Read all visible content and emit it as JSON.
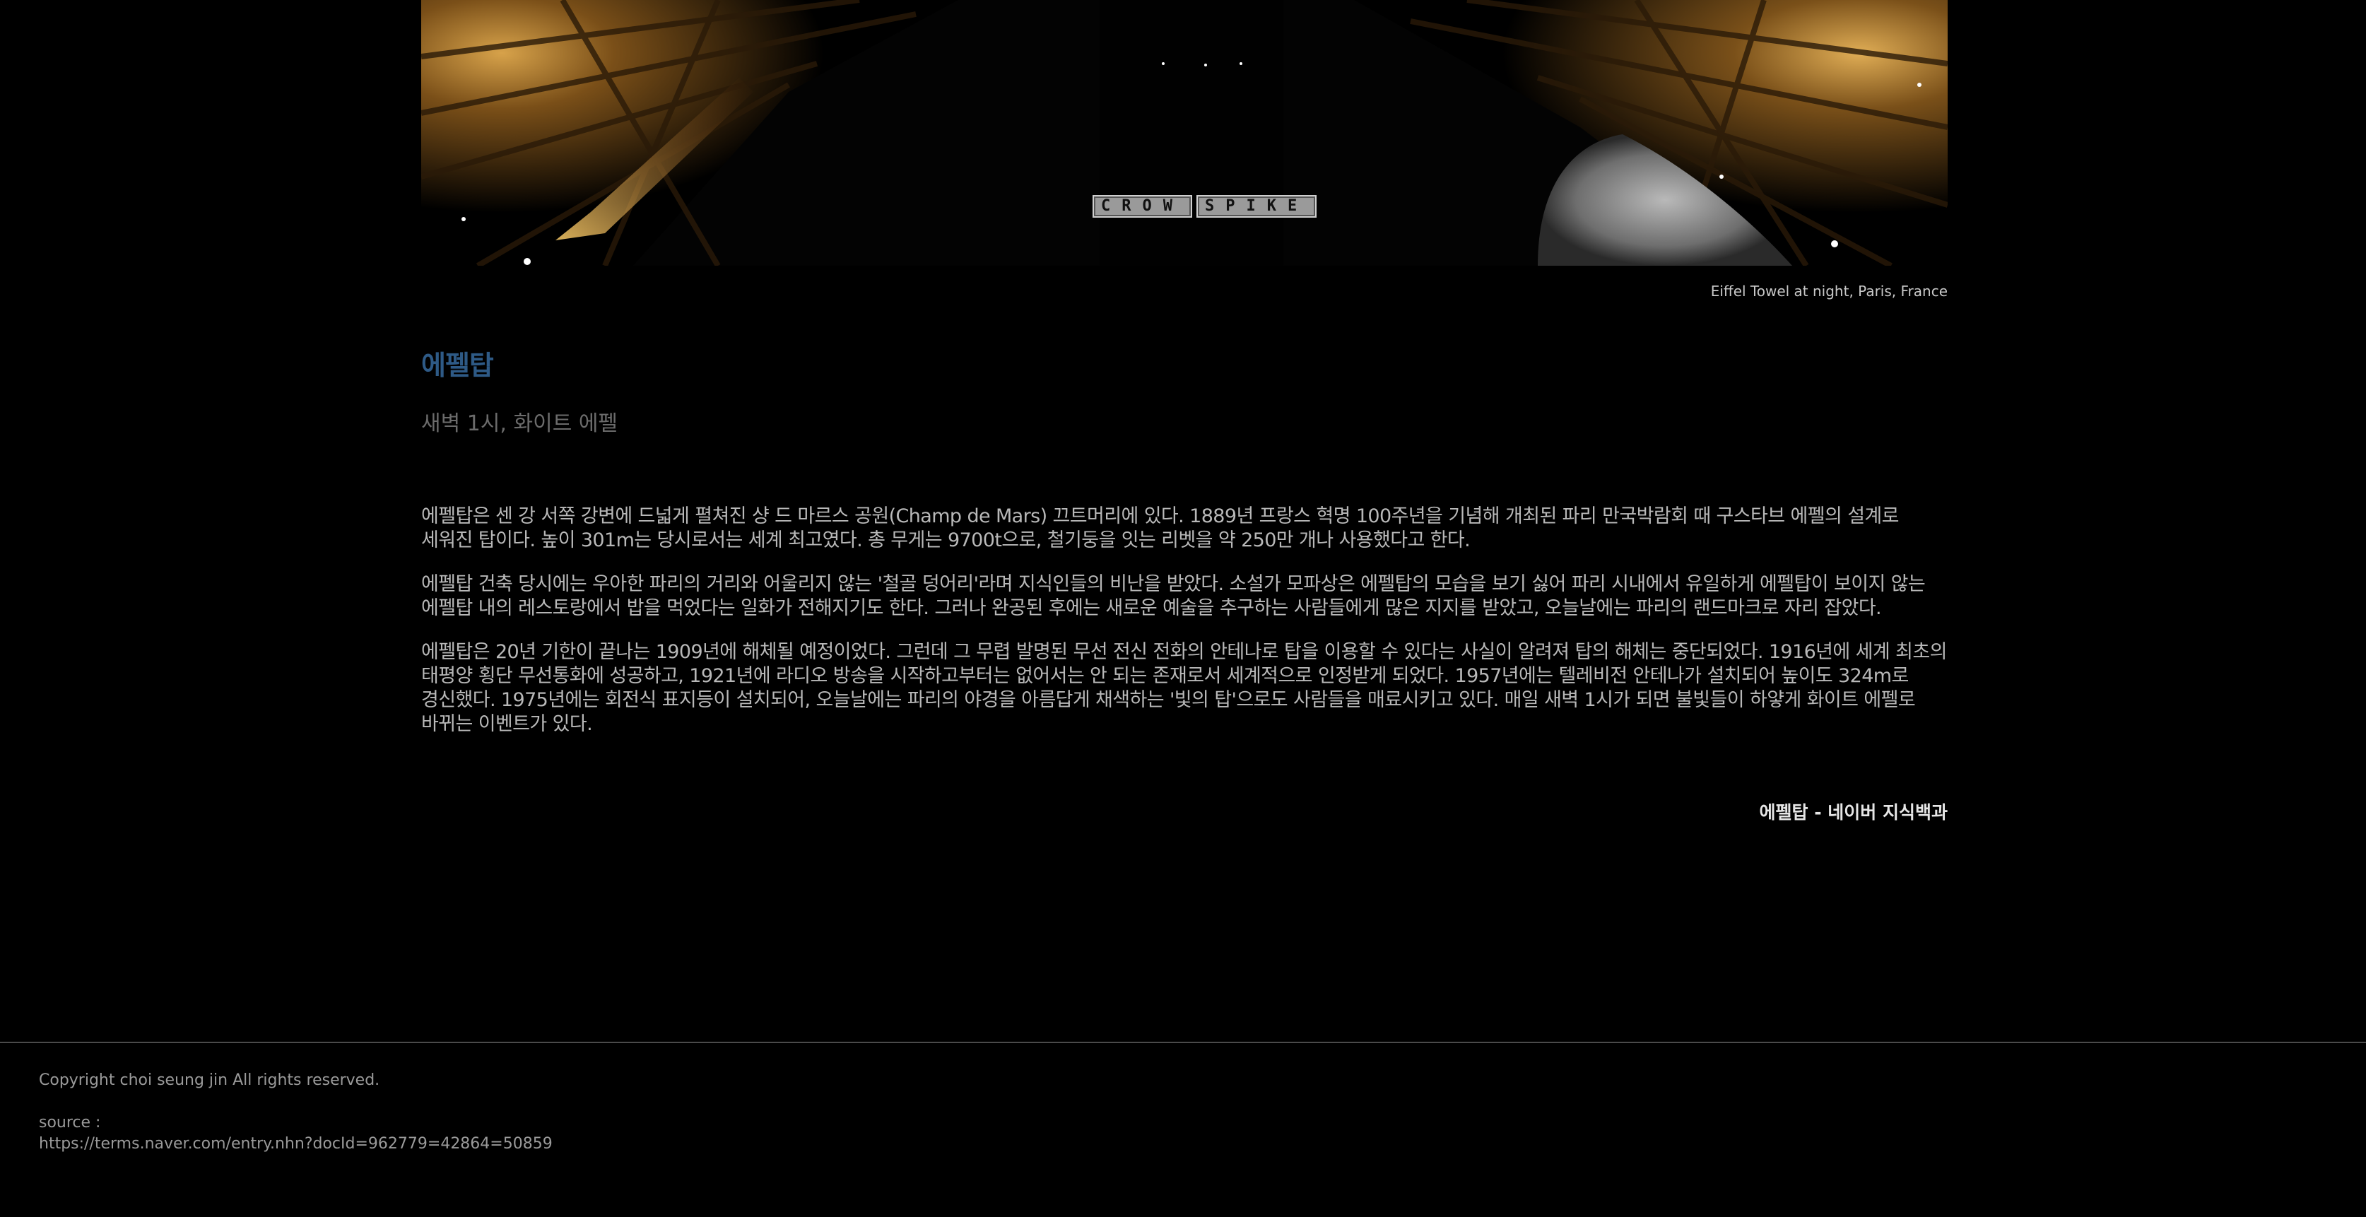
{
  "hero": {
    "watermark_left": "CROW",
    "watermark_right": "SPIKE",
    "caption": "Eiffel Towel at night, Paris, France"
  },
  "article": {
    "title": "에펠탑",
    "subtitle": "새벽 1시, 화이트 에펠",
    "paragraphs": [
      "에펠탑은 센 강 서쪽 강변에 드넓게 펼쳐진 샹 드 마르스 공원(Champ de Mars) 끄트머리에 있다. 1889년 프랑스 혁명 100주년을 기념해 개최된 파리 만국박람회 때 구스타브 에펠의 설계로 세워진 탑이다. 높이 301m는 당시로서는 세계 최고였다. 총 무게는 9700t으로, 철기둥을 잇는 리벳을 약 250만 개나 사용했다고 한다.",
      "에펠탑 건축 당시에는 우아한 파리의 거리와 어울리지 않는 '철골 덩어리'라며 지식인들의 비난을 받았다. 소설가 모파상은 에펠탑의 모습을 보기 싫어 파리 시내에서 유일하게 에펠탑이 보이지 않는 에펠탑 내의 레스토랑에서 밥을 먹었다는 일화가 전해지기도 한다. 그러나 완공된 후에는 새로운 예술을 추구하는 사람들에게 많은 지지를 받았고, 오늘날에는 파리의 랜드마크로 자리 잡았다.",
      "에펠탑은 20년 기한이 끝나는 1909년에 해체될 예정이었다. 그런데 그 무렵 발명된 무선 전신 전화의 안테나로 탑을 이용할 수 있다는 사실이 알려져 탑의 해체는 중단되었다. 1916년에 세계 최초의 태평양 횡단 무선통화에 성공하고, 1921년에 라디오 방송을 시작하고부터는 없어서는 안 되는 존재로서 세계적으로 인정받게 되었다. 1957년에는 텔레비전 안테나가 설치되어 높이도 324m로 경신했다. 1975년에는 회전식 표지등이 설치되어, 오늘날에는 파리의 야경을 아름답게 채색하는 '빛의 탑'으로도 사람들을 매료시키고 있다. 매일 새벽 1시가 되면 불빛들이 하얗게 화이트 에펠로 바뀌는 이벤트가 있다."
    ],
    "source_link": "에펠탑 - 네이버 지식백과"
  },
  "footer": {
    "copyright": "Copyright choi seung jin All rights reserved.",
    "source_label": "source :",
    "source_url": "https://terms.naver.com/entry.nhn?docId=962779=42864=50859"
  },
  "colors": {
    "background": "#000000",
    "title": "#2e5a86",
    "subtitle": "#6b6b6b",
    "body_text": "#b8b8b8",
    "footer_border": "#4a4a4a"
  }
}
